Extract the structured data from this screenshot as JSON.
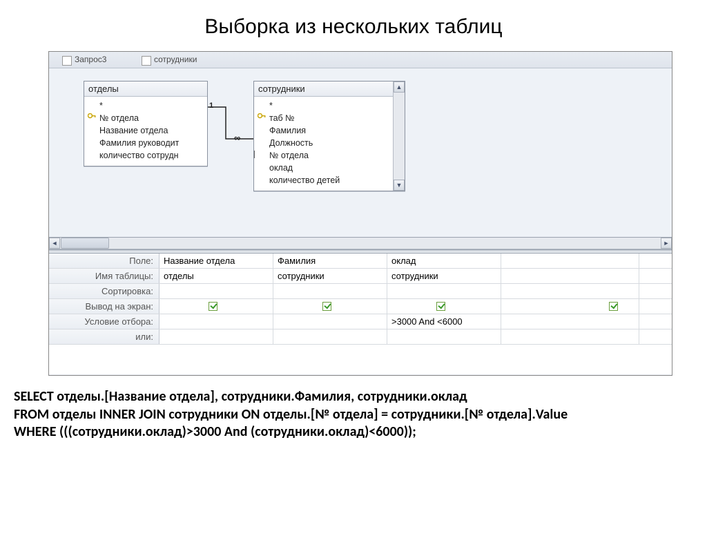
{
  "title": "Выборка из нескольких таблиц",
  "tabs": {
    "t1": "Запрос3",
    "t2": "сотрудники"
  },
  "table1": {
    "name": "отделы",
    "fields": {
      "star": "*",
      "key": "№ отдела",
      "f1": "Название отдела",
      "f2": "Фамилия руководит",
      "f3": "количество сотрудн"
    }
  },
  "table2": {
    "name": "сотрудники",
    "fields": {
      "star": "*",
      "key": "таб №",
      "f1": "Фамилия",
      "f2": "Должность",
      "f3": "№ отдела",
      "f4": "оклад",
      "f5": "количество детей"
    }
  },
  "join": {
    "one": "1",
    "many": "∞"
  },
  "grid": {
    "labels": {
      "field": "Поле:",
      "table": "Имя таблицы:",
      "sort": "Сортировка:",
      "show": "Вывод на экран:",
      "criteria": "Условие отбора:",
      "or": "или:"
    },
    "cols": [
      {
        "field": "Название отдела",
        "table": "отделы",
        "criteria": ""
      },
      {
        "field": "Фамилия",
        "table": "сотрудники",
        "criteria": ""
      },
      {
        "field": "оклад",
        "table": "сотрудники",
        "criteria": ">3000 And <6000"
      }
    ]
  },
  "sql": {
    "l1": "SELECT отделы.[Название отдела], сотрудники.Фамилия, сотрудники.оклад",
    "l2": "FROM отделы INNER JOIN сотрудники ON отделы.[№ отдела] = сотрудники.[№ отдела].Value",
    "l3": "WHERE (((сотрудники.оклад)>3000 And (сотрудники.оклад)<6000));"
  }
}
